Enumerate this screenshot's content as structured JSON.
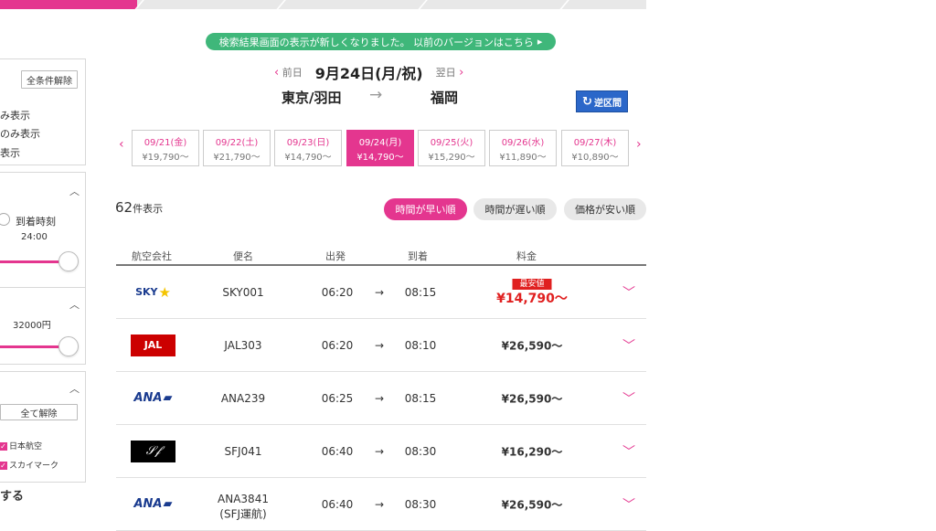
{
  "notice": {
    "text": "検索結果画面の表示が新しくなりました。 以前のバージョンはこちら",
    "icon": "triangle-right-icon"
  },
  "date_header": {
    "prev_label": "前日",
    "date": "9月24日(月/祝)",
    "next_label": "翌日"
  },
  "route": {
    "origin": "東京/羽田",
    "arrow": "→",
    "destination": "福岡",
    "reverse_label": "逆区間"
  },
  "date_tabs": [
    {
      "date": "09/21(金)",
      "price": "¥19,790〜",
      "active": false
    },
    {
      "date": "09/22(土)",
      "price": "¥21,790〜",
      "active": false
    },
    {
      "date": "09/23(日)",
      "price": "¥14,790〜",
      "active": false
    },
    {
      "date": "09/24(月)",
      "price": "¥14,790〜",
      "active": true
    },
    {
      "date": "09/25(火)",
      "price": "¥15,290〜",
      "active": false
    },
    {
      "date": "09/26(水)",
      "price": "¥11,890〜",
      "active": false
    },
    {
      "date": "09/27(木)",
      "price": "¥10,890〜",
      "active": false
    }
  ],
  "results": {
    "count": "62",
    "unit": "件表示"
  },
  "sort": {
    "early": "時間が早い順",
    "late": "時間が遅い順",
    "cheap": "価格が安い順",
    "active": "early"
  },
  "table": {
    "headers": {
      "airline": "航空会社",
      "flight": "便名",
      "depart": "出発",
      "arrive": "到着",
      "fare": "料金"
    },
    "rows": [
      {
        "airline_logo": "SKY",
        "flight": "SKY001",
        "depart": "06:20",
        "arrow": "→",
        "arrive": "08:15",
        "fare": "¥14,790〜",
        "badge": "最安値"
      },
      {
        "airline_logo": "JAL",
        "flight": "JAL303",
        "depart": "06:20",
        "arrow": "→",
        "arrive": "08:10",
        "fare": "¥26,590〜"
      },
      {
        "airline_logo": "ANA",
        "flight": "ANA239",
        "depart": "06:25",
        "arrow": "→",
        "arrive": "08:15",
        "fare": "¥26,590〜"
      },
      {
        "airline_logo": "SFJ",
        "flight": "SFJ041",
        "depart": "06:40",
        "arrow": "→",
        "arrive": "08:30",
        "fare": "¥16,290〜"
      },
      {
        "airline_logo": "ANA",
        "flight": "ANA3841",
        "flight_sub": "(SFJ運航)",
        "depart": "06:40",
        "arrow": "→",
        "arrive": "08:30",
        "fare": "¥26,590〜"
      }
    ]
  },
  "sidebar": {
    "clear_all": "全条件解除",
    "display_opts": [
      "み表示",
      "のみ表示",
      "表示"
    ],
    "arrival_time_label": "到着時刻",
    "arrival_time_value": "24:00",
    "price_value": "32000円",
    "release_all": "全て解除",
    "airlines": [
      "日本航空",
      "スカイマーク"
    ],
    "bottom_text": "する"
  },
  "colors": {
    "accent": "#e4368f",
    "notice": "#3fb77a",
    "reverse_btn": "#2b67c9",
    "cheapest": "#e02020"
  }
}
